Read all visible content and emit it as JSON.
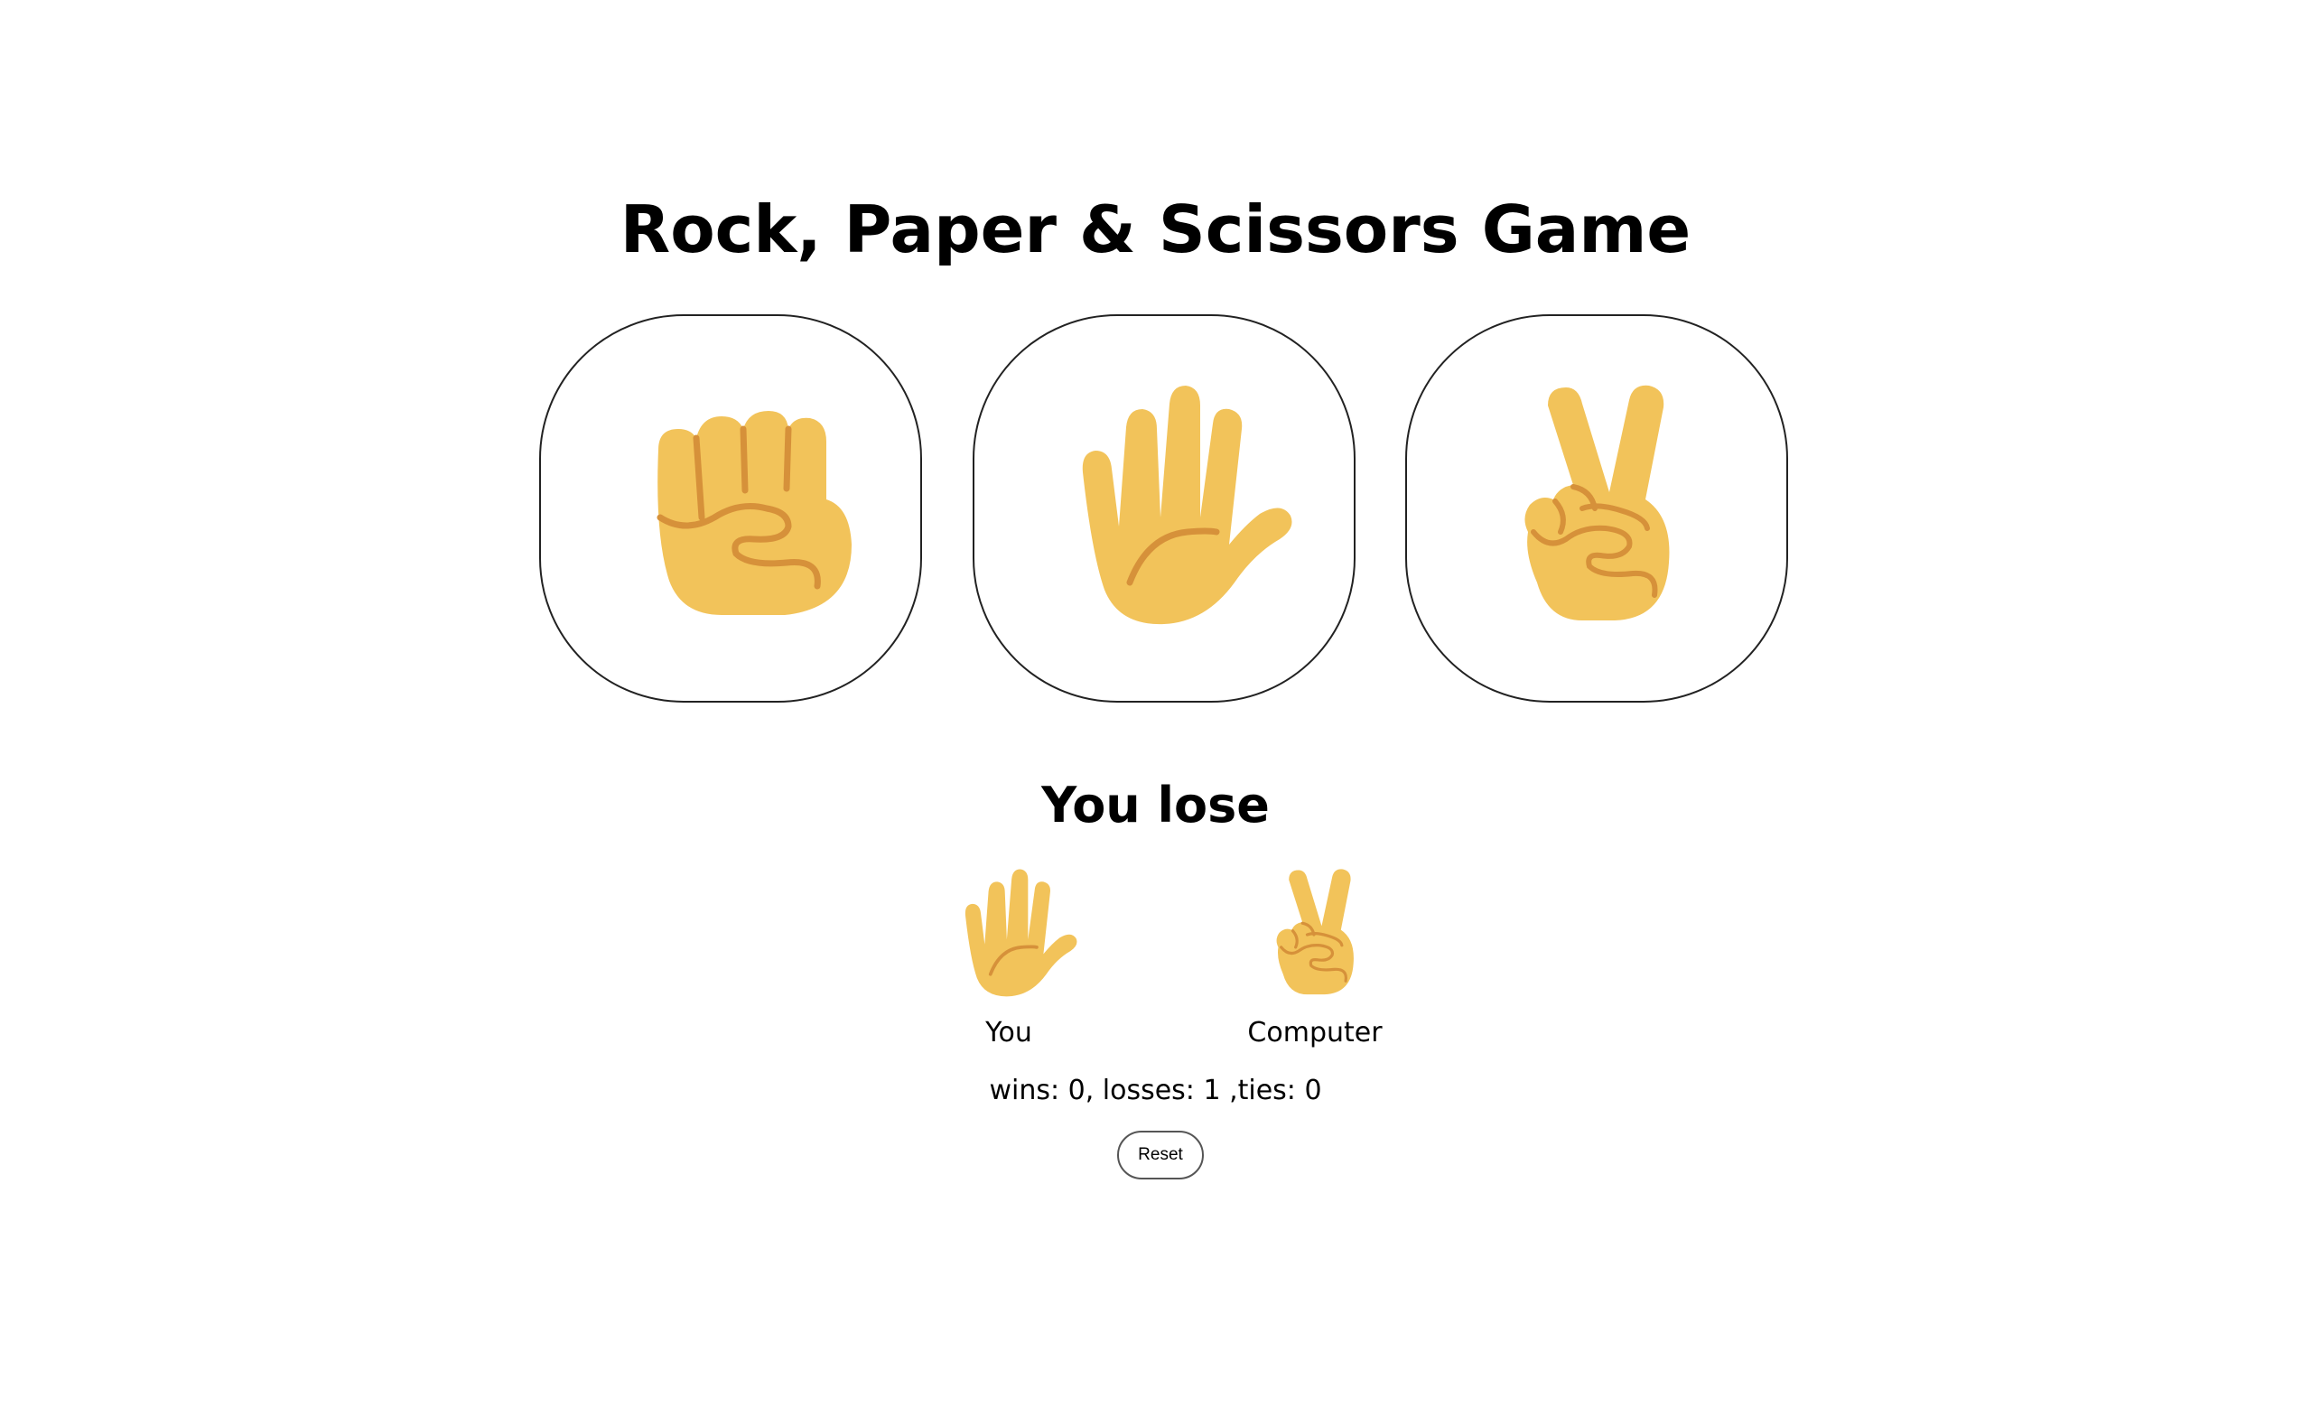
{
  "title": "Rock, Paper & Scissors Game",
  "choices": [
    {
      "id": "rock",
      "icon": "fist-icon"
    },
    {
      "id": "paper",
      "icon": "raised-hand-icon"
    },
    {
      "id": "scissors",
      "icon": "victory-hand-icon"
    }
  ],
  "result": {
    "text": "You lose",
    "you_label": "You",
    "you_icon": "raised-hand-icon",
    "computer_label": "Computer",
    "computer_icon": "victory-hand-icon"
  },
  "score": {
    "text": "wins: 0, losses: 1 ,ties: 0",
    "wins": 0,
    "losses": 1,
    "ties": 0
  },
  "reset_label": "Reset",
  "colors": {
    "skin": "#F2C35A",
    "crease": "#D6913A"
  }
}
